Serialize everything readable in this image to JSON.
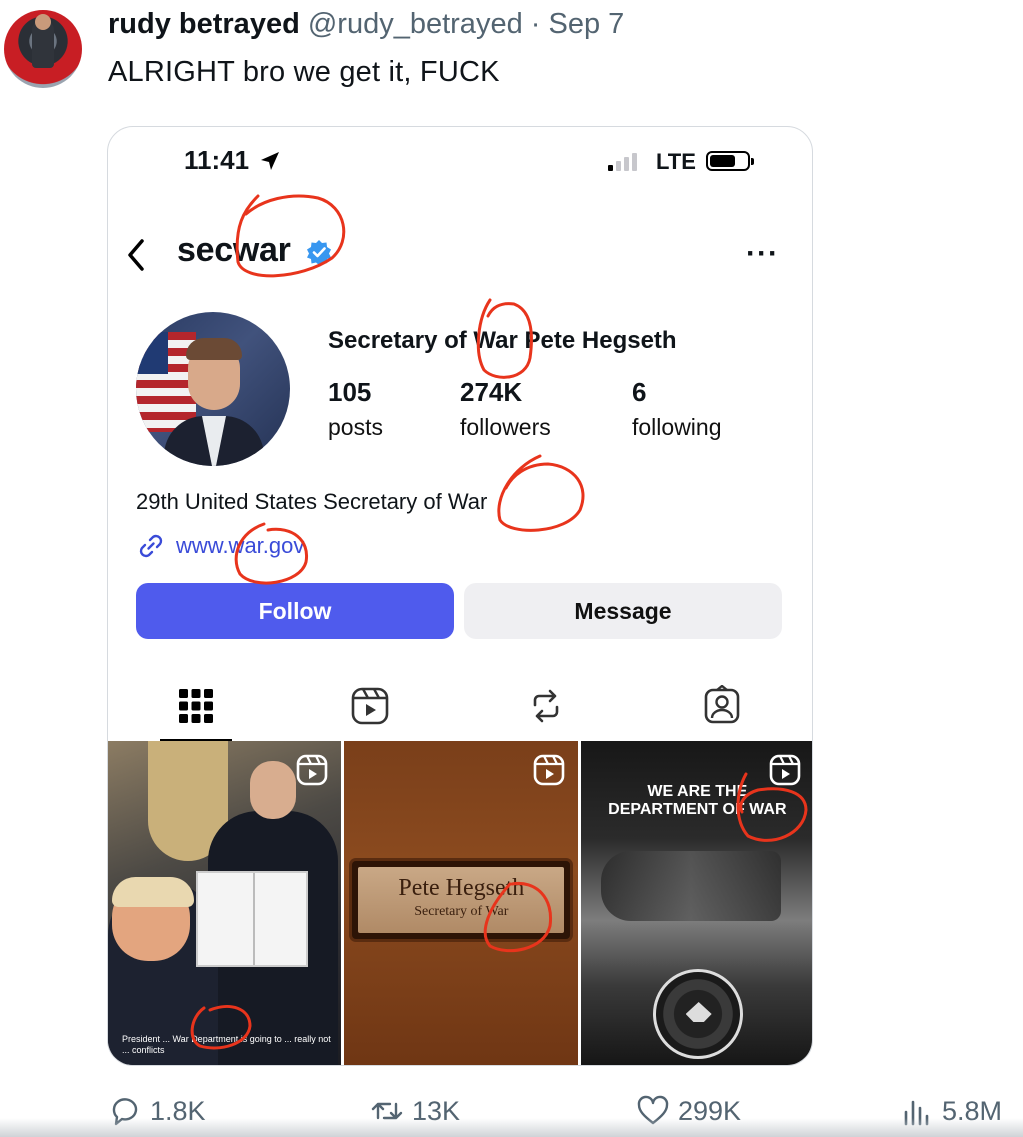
{
  "tweet": {
    "display_name": "rudy betrayed",
    "handle": "@rudy_betrayed",
    "separator": "·",
    "date": "Sep 7",
    "text": "ALRIGHT bro we get it, FUCK"
  },
  "phone": {
    "status_time": "11:41",
    "network": "LTE",
    "signal_bars_on": 1,
    "signal_bars_total": 4,
    "battery_level": 0.7
  },
  "profile": {
    "username": "secwar",
    "verified": true,
    "full_name": "Secretary of War Pete Hegseth",
    "stats": [
      {
        "value": "105",
        "label": "posts"
      },
      {
        "value": "274K",
        "label": "followers"
      },
      {
        "value": "6",
        "label": "following"
      }
    ],
    "bio": "29th United States Secretary of War",
    "link": "www.war.gov",
    "follow_label": "Follow",
    "message_label": "Message",
    "accent_color": "#4f5bed"
  },
  "posts": {
    "cell1_caption": "President ... War Department is going to ... really not ... conflicts",
    "cell2_nameplate_name": "Pete Hegseth",
    "cell2_nameplate_title": "Secretary of War",
    "cell3_headline_1": "WE ARE THE",
    "cell3_headline_2": "DEPARTMENT OF WAR"
  },
  "engagement": {
    "replies": "1.8K",
    "reposts": "13K",
    "likes": "299K",
    "views": "5.8M"
  },
  "annotation_color": "#e8341c"
}
